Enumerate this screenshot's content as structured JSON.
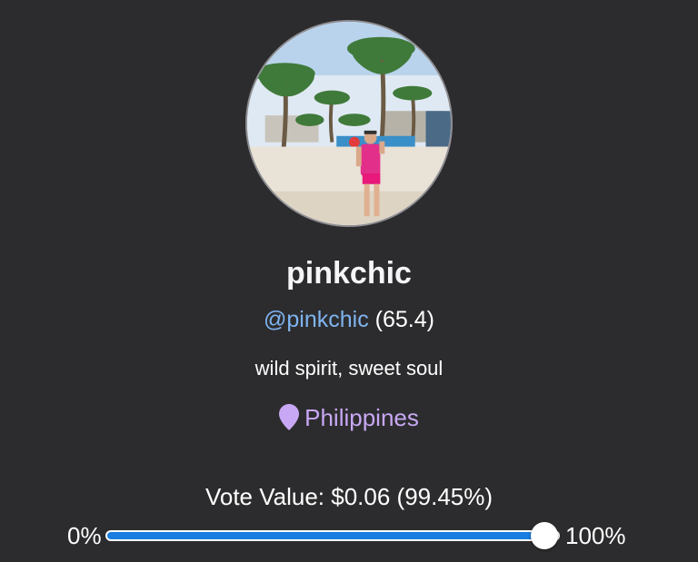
{
  "profile": {
    "display_name": "pinkchic",
    "handle": "@pinkchic",
    "reputation": "(65.4)",
    "bio": "wild spirit, sweet soul",
    "location": "Philippines",
    "avatar_icon": "profile-photo-beach"
  },
  "vote": {
    "label": "Vote Value: $0.06 (99.45%)",
    "slider_min_label": "0%",
    "slider_max_label": "100%",
    "slider_value_percent": 99.45
  },
  "colors": {
    "background": "#2c2c2e",
    "handle": "#7fb4f0",
    "location": "#c8a8f4",
    "slider_fill": "#1a7de0"
  }
}
